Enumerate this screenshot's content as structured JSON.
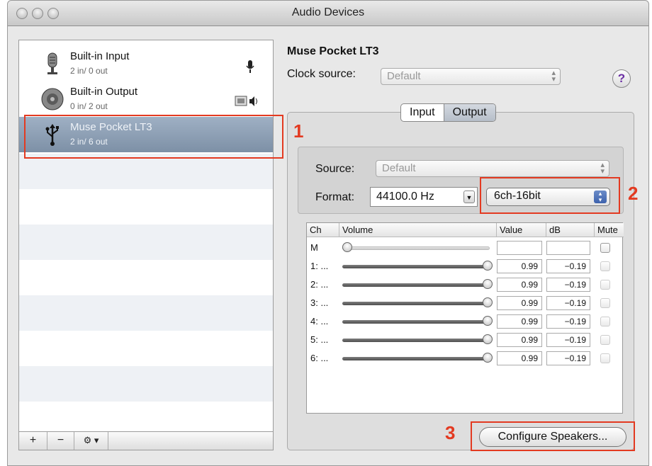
{
  "window": {
    "title": "Audio Devices"
  },
  "devices": [
    {
      "name": "Built-in Input",
      "io": "2 in/ 0 out",
      "icon": "microphone-icon"
    },
    {
      "name": "Built-in Output",
      "io": "0 in/ 2 out",
      "icon": "speaker-icon"
    },
    {
      "name": "Muse Pocket LT3",
      "io": "2 in/ 6 out",
      "icon": "usb-icon",
      "selected": true
    }
  ],
  "list_toolbar": {
    "add": "+",
    "remove": "−",
    "gear": "⚙ ▾"
  },
  "detail": {
    "device_name": "Muse Pocket LT3",
    "clock_label": "Clock source:",
    "clock_value": "Default",
    "help": "?",
    "tabs": [
      "Input",
      "Output"
    ],
    "active_tab": "Output",
    "source_label": "Source:",
    "source_value": "Default",
    "format_label": "Format:",
    "format_rate": "44100.0 Hz",
    "format_bits": "6ch-16bit",
    "table_headers": [
      "Ch",
      "Volume",
      "Value",
      "dB",
      "Mute"
    ],
    "channels": [
      {
        "ch": "M",
        "value": "",
        "db": "",
        "level": 0.0
      },
      {
        "ch": "1: ...",
        "value": "0.99",
        "db": "−0.19",
        "level": 0.99
      },
      {
        "ch": "2: ...",
        "value": "0.99",
        "db": "−0.19",
        "level": 0.99
      },
      {
        "ch": "3: ...",
        "value": "0.99",
        "db": "−0.19",
        "level": 0.99
      },
      {
        "ch": "4: ...",
        "value": "0.99",
        "db": "−0.19",
        "level": 0.99
      },
      {
        "ch": "5: ...",
        "value": "0.99",
        "db": "−0.19",
        "level": 0.99
      },
      {
        "ch": "6: ...",
        "value": "0.99",
        "db": "−0.19",
        "level": 0.99
      }
    ],
    "configure_button": "Configure Speakers..."
  },
  "annotations": [
    "1",
    "2",
    "3"
  ],
  "colors": {
    "annotation_red": "#e33a21",
    "selection": "#8d9fb5"
  }
}
